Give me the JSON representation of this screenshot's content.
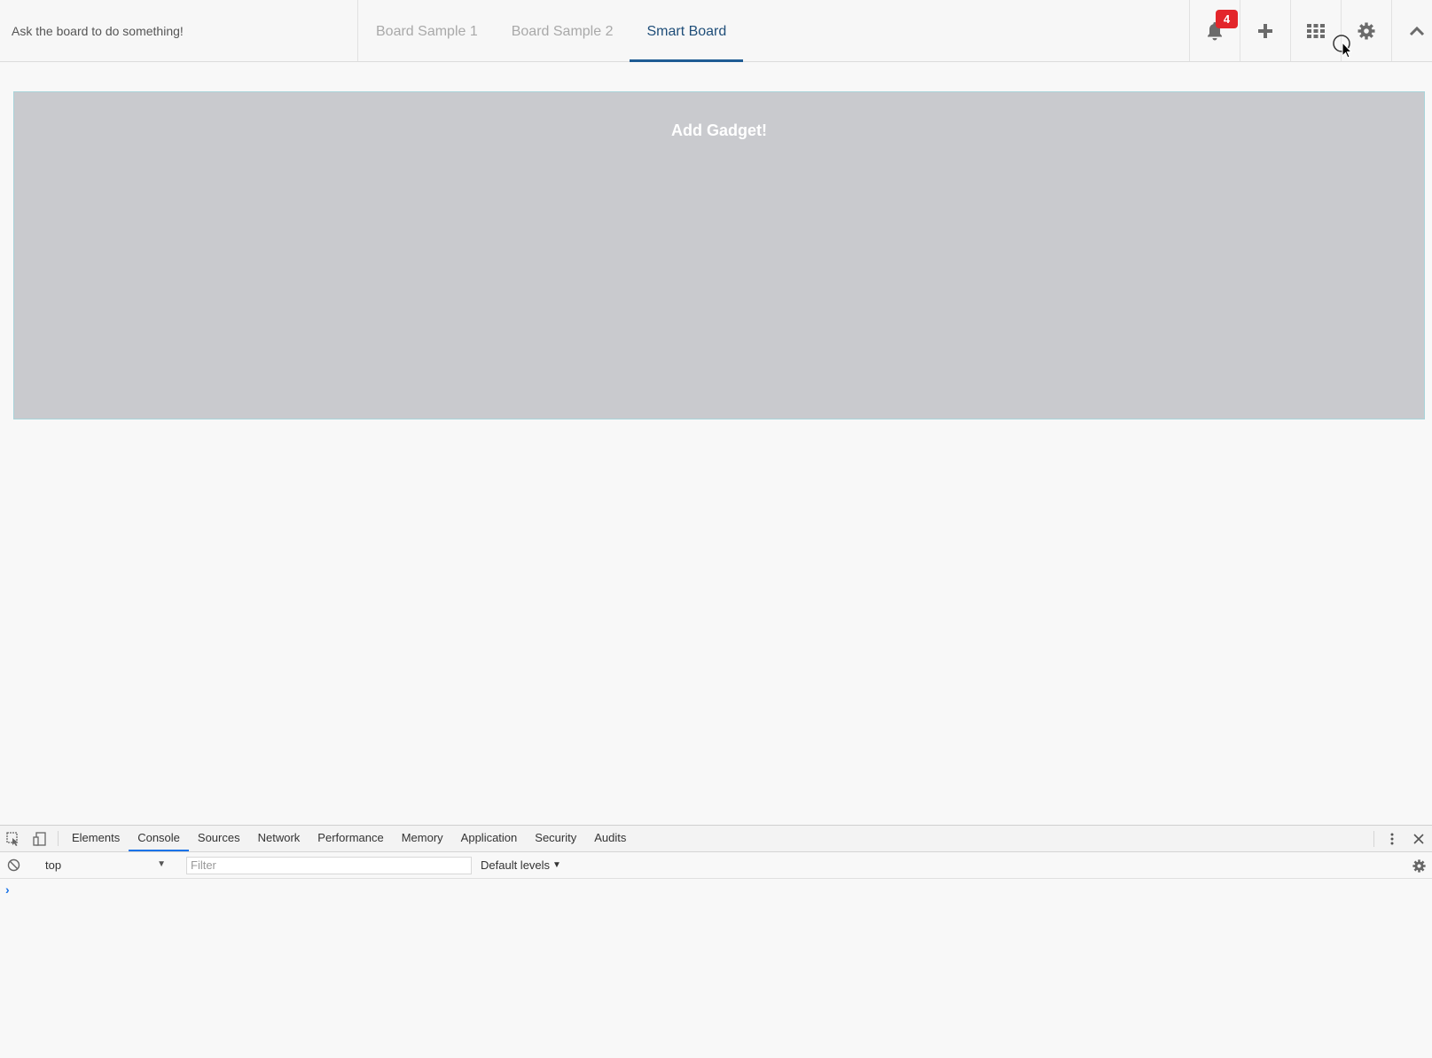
{
  "topbar": {
    "ask_placeholder": "Ask the board to do something!",
    "tabs": [
      {
        "label": "Board Sample 1",
        "active": false
      },
      {
        "label": "Board Sample 2",
        "active": false
      },
      {
        "label": "Smart Board",
        "active": true
      }
    ],
    "notifications_count": "4",
    "icons": [
      "bell-icon",
      "plus-icon",
      "grid-icon",
      "gear-icon",
      "chevron-up-icon"
    ]
  },
  "main": {
    "add_gadget_label": "Add Gadget!"
  },
  "devtools": {
    "tabs": [
      "Elements",
      "Console",
      "Sources",
      "Network",
      "Performance",
      "Memory",
      "Application",
      "Security",
      "Audits"
    ],
    "active_tab": "Console",
    "context": "top",
    "filter_placeholder": "Filter",
    "levels": "Default levels",
    "prompt": "›"
  },
  "colors": {
    "accent": "#1f5c94",
    "badge": "#e3262b",
    "gadget_bg": "#c9cace",
    "devtools_accent": "#1a73e8"
  }
}
